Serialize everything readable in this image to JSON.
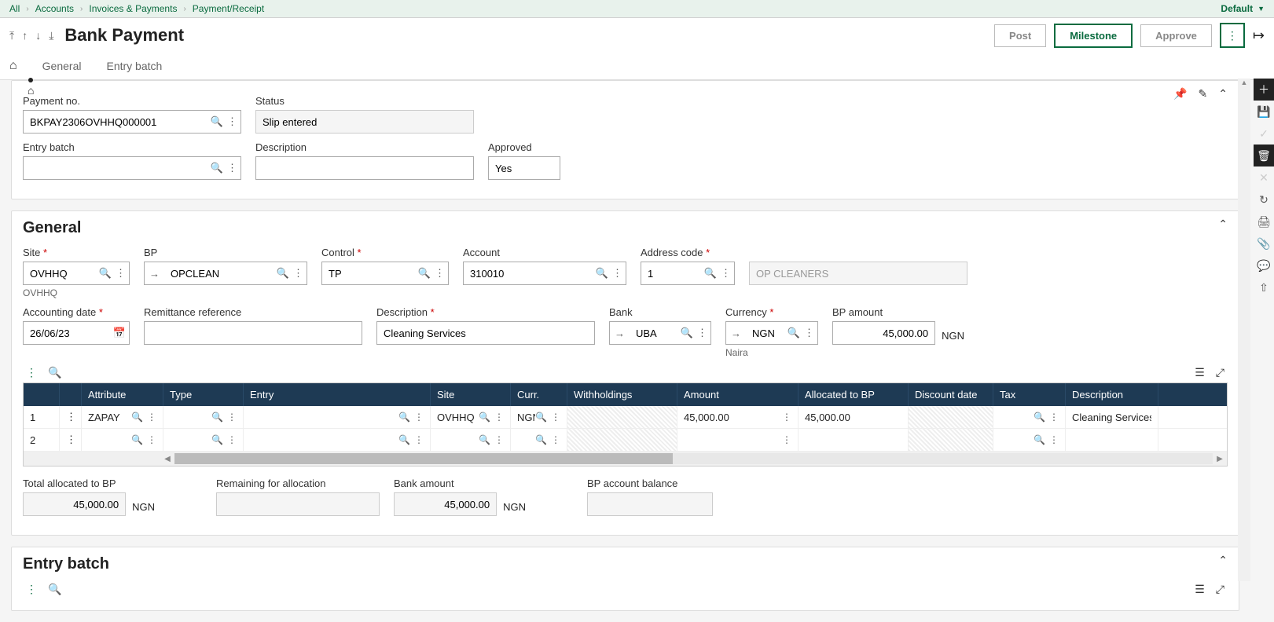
{
  "breadcrumb": {
    "items": [
      "All",
      "Accounts",
      "Invoices & Payments",
      "Payment/Receipt"
    ],
    "right_label": "Default"
  },
  "header": {
    "title": "Bank Payment",
    "buttons": {
      "post": "Post",
      "milestone": "Milestone",
      "approve": "Approve"
    }
  },
  "tabs": [
    "General",
    "Entry batch"
  ],
  "top_panel": {
    "payment_no_label": "Payment no.",
    "payment_no": "BKPAY2306OVHHQ000001",
    "status_label": "Status",
    "status": "Slip entered",
    "entry_batch_label": "Entry batch",
    "entry_batch": "",
    "description_label": "Description",
    "description": "",
    "approved_label": "Approved",
    "approved": "Yes"
  },
  "general": {
    "title": "General",
    "site_label": "Site",
    "site": "OVHHQ",
    "site_sub": "OVHHQ",
    "bp_label": "BP",
    "bp": "OPCLEAN",
    "control_label": "Control",
    "control": "TP",
    "account_label": "Account",
    "account": "310010",
    "address_label": "Address code",
    "address": "1",
    "address_name": "OP CLEANERS",
    "accdate_label": "Accounting date",
    "accdate": "26/06/23",
    "remit_label": "Remittance reference",
    "remit": "",
    "desc_label": "Description",
    "desc": "Cleaning Services",
    "bank_label": "Bank",
    "bank": "UBA",
    "curr_label": "Currency",
    "curr": "NGN",
    "curr_sub": "Naira",
    "bpamt_label": "BP amount",
    "bpamt": "45,000.00",
    "bpamt_suffix": "NGN"
  },
  "table": {
    "headers": [
      "",
      "",
      "Attribute",
      "Type",
      "Entry",
      "Site",
      "Curr.",
      "Withholdings",
      "Amount",
      "Allocated to BP",
      "Discount date",
      "Tax",
      "Description"
    ],
    "rows": [
      {
        "num": "1",
        "attr": "ZAPAY",
        "type": "",
        "entry": "",
        "site": "OVHHQ",
        "curr": "NGN",
        "with": "",
        "amount": "45,000.00",
        "alloc": "45,000.00",
        "disc": "",
        "tax": "",
        "desc": "Cleaning Services"
      },
      {
        "num": "2",
        "attr": "",
        "type": "",
        "entry": "",
        "site": "",
        "curr": "",
        "with": "",
        "amount": "",
        "alloc": "",
        "disc": "",
        "tax": "",
        "desc": ""
      }
    ]
  },
  "totals": {
    "total_alloc_label": "Total allocated to BP",
    "total_alloc": "45,000.00",
    "total_alloc_suffix": "NGN",
    "remain_label": "Remaining for allocation",
    "remain": "",
    "bankamt_label": "Bank amount",
    "bankamt": "45,000.00",
    "bankamt_suffix": "NGN",
    "bpbal_label": "BP account balance",
    "bpbal": ""
  },
  "entry_batch": {
    "title": "Entry batch"
  }
}
